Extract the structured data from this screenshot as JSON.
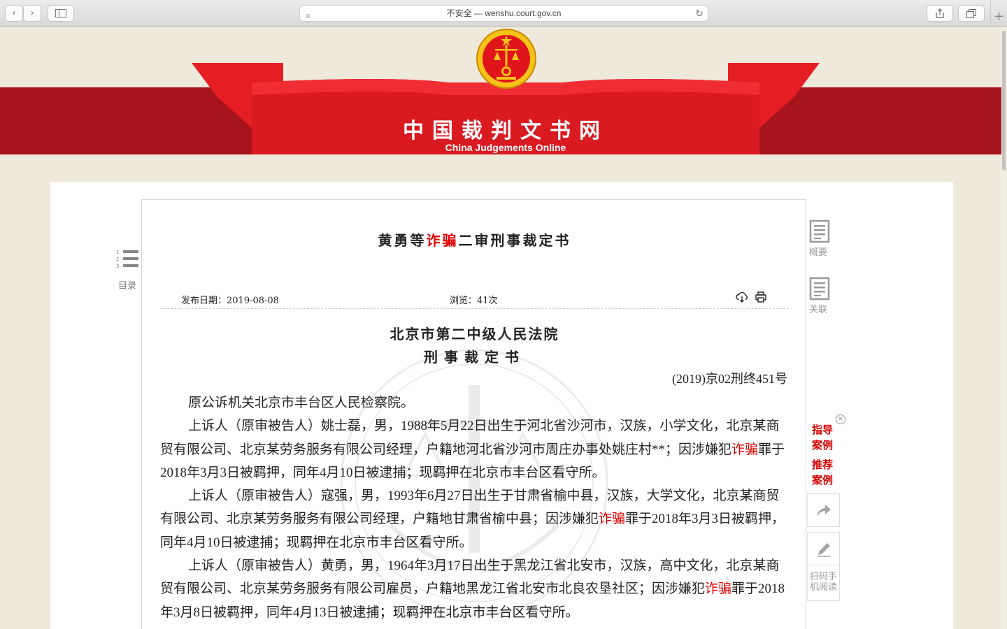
{
  "browser": {
    "address": "不安全 — wenshu.court.gov.cn",
    "plus": "+"
  },
  "site": {
    "title_cn": "中国裁判文书网",
    "title_en": "China Judgements Online"
  },
  "toc": {
    "label": "目录"
  },
  "document": {
    "title_pre": "黄勇等",
    "title_hl": "诈骗",
    "title_post": "二审刑事裁定书",
    "publish_date": "发布日期：2019-08-08",
    "views": "浏览：41次",
    "court": "北京市第二中级人民法院",
    "doc_type": "刑事裁定书",
    "case_no": "(2019)京02刑终451号",
    "p1": "原公诉机关北京市丰台区人民检察院。",
    "p2_a": "上诉人（原审被告人）姚士磊，男，1988年5月22日出生于河北省沙河市，汉族，小学文化，北京某商贸有限公司、北京某劳务服务有限公司经理，户籍地河北省沙河市周庄办事处姚庄村**；因涉嫌犯",
    "p2_hl": "诈骗",
    "p2_b": "罪于2018年3月3日被羁押，同年4月10日被逮捕；现羁押在北京市丰台区看守所。",
    "p3_a": "上诉人（原审被告人）寇强，男，1993年6月27日出生于甘肃省榆中县，汉族，大学文化，北京某商贸有限公司、北京某劳务服务有限公司经理，户籍地甘肃省榆中县；因涉嫌犯",
    "p3_hl": "诈骗",
    "p3_b": "罪于2018年3月3日被羁押，同年4月10日被逮捕；现羁押在北京市丰台区看守所。",
    "p4_a": "上诉人（原审被告人）黄勇，男，1964年3月17日出生于黑龙江省北安市，汉族，高中文化，北京某商贸有限公司、北京某劳务服务有限公司雇员，户籍地黑龙江省北安市北良农垦社区；因涉嫌犯",
    "p4_hl": "诈骗",
    "p4_b": "罪于2018年3月8日被羁押，同年4月13日被逮捕；现羁押在北京市丰台区看守所。"
  },
  "side": {
    "summary": "概要",
    "related": "关联",
    "guide1": "指导",
    "guide2": "案例",
    "rec1": "推荐",
    "rec2": "案例",
    "scan1": "扫码手",
    "scan2": "机阅读"
  },
  "icons": {
    "back": "chevron-left-icon",
    "forward": "chevron-right-icon",
    "sidebar": "sidebar-icon",
    "share": "share-icon",
    "tabs": "tabs-icon",
    "reload": "reload-icon",
    "download": "download-icon",
    "print": "printer-icon",
    "forward_share": "share-arrow-icon",
    "edit": "pencil-icon"
  },
  "colors": {
    "banner_red": "#a8141c",
    "highlight": "#e00000",
    "background": "#efe9dc"
  }
}
